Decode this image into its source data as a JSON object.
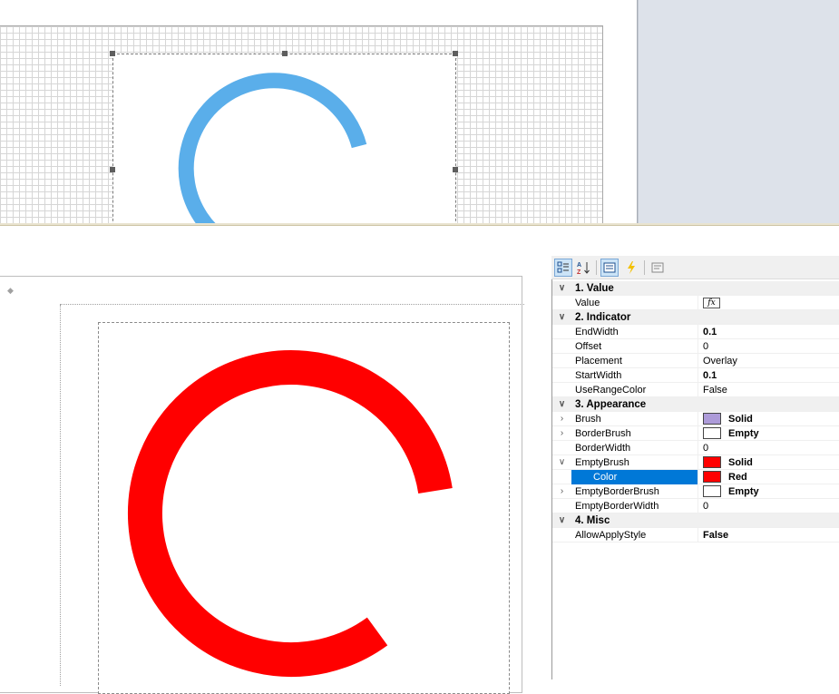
{
  "colors": {
    "gauge_blue": "#5aaeea",
    "gauge_red": "#ff0000",
    "brush_lavender": "#ad9bd9",
    "selection": "#0078d7"
  },
  "preview": {
    "nav_arrow": "◆"
  },
  "toolbar": {
    "categorized_icon": "categorized-icon",
    "alphabetical_icon": "alphabetical-icon",
    "properties_icon": "properties-icon",
    "events_icon": "lightning-icon",
    "property_pages_icon": "property-pages-icon"
  },
  "properties": {
    "cat_value": "1. Value",
    "value_name": "Value",
    "value_fx": "fx",
    "cat_indicator": "2. Indicator",
    "endwidth_name": "EndWidth",
    "endwidth_val": "0.1",
    "offset_name": "Offset",
    "offset_val": "0",
    "placement_name": "Placement",
    "placement_val": "Overlay",
    "startwidth_name": "StartWidth",
    "startwidth_val": "0.1",
    "userangecolor_name": "UseRangeColor",
    "userangecolor_val": "False",
    "cat_appearance": "3. Appearance",
    "brush_name": "Brush",
    "brush_val": "Solid",
    "borderbrush_name": "BorderBrush",
    "borderbrush_val": "Empty",
    "borderwidth_name": "BorderWidth",
    "borderwidth_val": "0",
    "emptybrush_name": "EmptyBrush",
    "emptybrush_val": "Solid",
    "color_name": "Color",
    "color_val": "Red",
    "emptyborderbrush_name": "EmptyBorderBrush",
    "emptyborderbrush_val": "Empty",
    "emptyborderwidth_name": "EmptyBorderWidth",
    "emptyborderwidth_val": "0",
    "cat_misc": "4. Misc",
    "allowapplystyle_name": "AllowApplyStyle",
    "allowapplystyle_val": "False"
  }
}
